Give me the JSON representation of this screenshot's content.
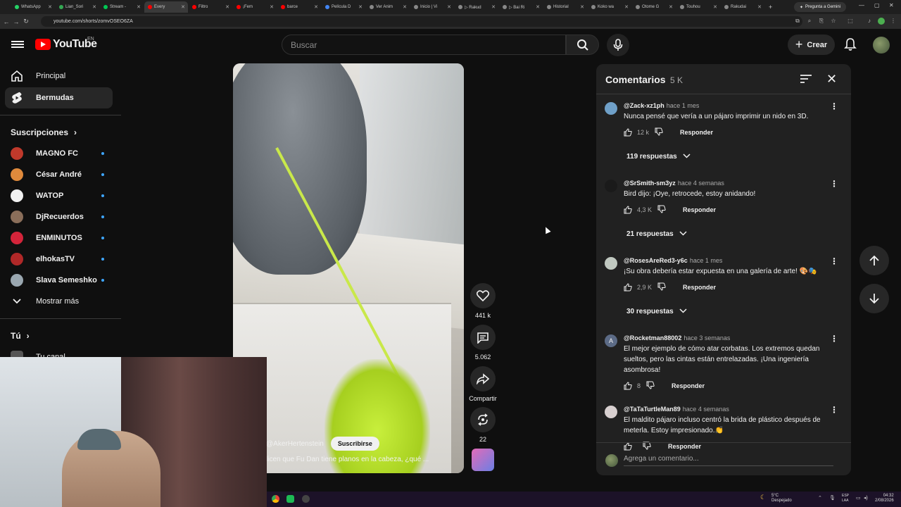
{
  "browser": {
    "tabs": [
      {
        "label": "WhatsApp",
        "color": "#25d366",
        "active": false
      },
      {
        "label": "Lian_Sori",
        "color": "#34a853",
        "active": false
      },
      {
        "label": "Stream - ",
        "color": "#00c853",
        "active": false
      },
      {
        "label": "Every",
        "color": "#ff0000",
        "active": true
      },
      {
        "label": "Filtro",
        "color": "#ff0000",
        "active": false
      },
      {
        "label": "¡Fem",
        "color": "#ff0000",
        "active": false
      },
      {
        "label": "barce",
        "color": "#ff0000",
        "active": false
      },
      {
        "label": "Película D",
        "color": "#4285f4",
        "active": false
      },
      {
        "label": "Ver Anim",
        "color": "#888888",
        "active": false
      },
      {
        "label": "Inicio | Vi",
        "color": "#888888",
        "active": false
      },
      {
        "label": "▷ Rakud",
        "color": "#888888",
        "active": false
      },
      {
        "label": "▷ Bai Ri",
        "color": "#888888",
        "active": false
      },
      {
        "label": "Historial",
        "color": "#888888",
        "active": false
      },
      {
        "label": "Koko wa",
        "color": "#888888",
        "active": false
      },
      {
        "label": "Otome G",
        "color": "#888888",
        "active": false
      },
      {
        "label": "Touhou",
        "color": "#888888",
        "active": false
      },
      {
        "label": "Rakudai",
        "color": "#888888",
        "active": false
      }
    ],
    "gemini_label": "Pregunta a Gemini",
    "url": "youtube.com/shorts/zomvOSEO6ZA"
  },
  "header": {
    "logo_text": "YouTube",
    "logo_region": "EN",
    "search_placeholder": "Buscar",
    "create_label": "Crear"
  },
  "sidebar": {
    "items": [
      {
        "label": "Principal",
        "icon": "home-icon"
      },
      {
        "label": "Bermudas",
        "icon": "shorts-icon"
      }
    ],
    "subscriptions_title": "Suscripciones",
    "subscriptions": [
      {
        "name": "MAGNO FC",
        "color": "#c0392b"
      },
      {
        "name": "César André",
        "color": "#e08a3c"
      },
      {
        "name": "WATOP",
        "color": "#f1f1f1"
      },
      {
        "name": "DjRecuerdos",
        "color": "#8a6e5a"
      },
      {
        "name": "ENMINUTOS",
        "color": "#d3243a"
      },
      {
        "name": "elhokasTV",
        "color": "#b02828"
      },
      {
        "name": "Slava Semeshko",
        "color": "#9aa7b0"
      }
    ],
    "show_more": "Mostrar más",
    "you_title": "Tú",
    "your_channel": "Tu canal"
  },
  "video": {
    "channel": "@AkerHertenstein",
    "subscribe": "Suscribirse",
    "description": "licen que Fu Dan tiene planos en la cabeza, ¿qué ..."
  },
  "actions": {
    "likes": "441 k",
    "comments": "5.062",
    "share": "Compartir",
    "remix": "22"
  },
  "comments_panel": {
    "title": "Comentarios",
    "count": "5 K",
    "add_placeholder": "Agrega un comentario...",
    "comments": [
      {
        "author": "@Zack-xz1ph",
        "time": "hace 1 mes",
        "text": "Nunca pensé que vería a un pájaro imprimir un nido en 3D.",
        "likes": "12 k",
        "replies": "119 respuestas",
        "avatar_color": "#6fa0c8"
      },
      {
        "author": "@SrSmith-sm3yz",
        "time": "hace 4 semanas",
        "text": "Bird dijo: ¡Oye, retrocede, estoy anidando!",
        "likes": "4,3 K",
        "replies": "21 respuestas",
        "avatar_color": "#1a1a1a"
      },
      {
        "author": "@RosesAreRed3-y6c",
        "time": "hace 1 mes",
        "text": "¡Su obra debería estar expuesta en una galería de arte! 🎨🎭",
        "likes": "2,9 K",
        "replies": "30 respuestas",
        "avatar_color": "#c0c8c0"
      },
      {
        "author": "@Rocketman88002",
        "time": "hace 3 semanas",
        "text": "El mejor ejemplo de cómo atar corbatas. Los extremos quedan sueltos, pero las cintas están entrelazadas. ¡Una ingeniería asombrosa!",
        "likes": "8",
        "avatar_letter": "A",
        "avatar_color": "#5c6b86"
      },
      {
        "author": "@TaTaTurtleMan89",
        "time": "hace 4 semanas",
        "text": "El maldito pájaro incluso centró la brida de plástico después de meterla. Estoy impresionado.👏",
        "likes": "",
        "avatar_color": "#d8d0d0"
      }
    ],
    "reply_label": "Responder"
  },
  "taskbar": {
    "weather_temp": "5°C",
    "weather_desc": "Despejado",
    "lang": "ESP",
    "lang2": "LAA",
    "time": "04:32",
    "date": "2/08/2026"
  }
}
